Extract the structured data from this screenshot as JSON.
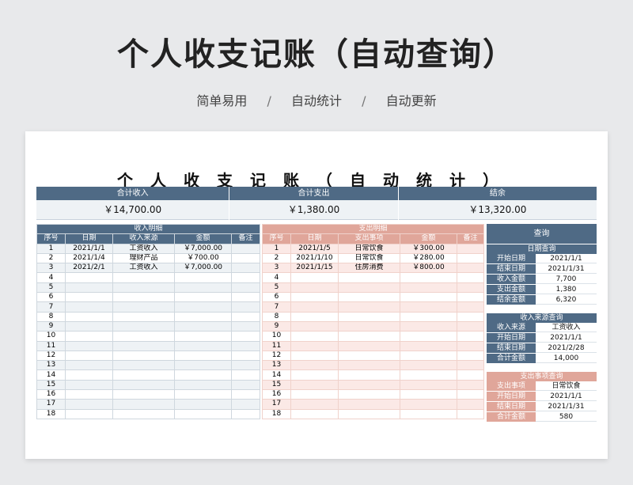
{
  "title": "个人收支记账（自动查询）",
  "subtitle": [
    "简单易用",
    "自动统计",
    "自动更新"
  ],
  "subtitle_sep": "/",
  "sheet": {
    "title": "个人收支记账（自动统计）",
    "summary": [
      {
        "label": "合计收入",
        "value": "￥14,700.00"
      },
      {
        "label": "合计支出",
        "value": "￥1,380.00"
      },
      {
        "label": "结余",
        "value": "￥13,320.00"
      }
    ],
    "income": {
      "title": "收入明细",
      "columns": [
        "序号",
        "日期",
        "收入来源",
        "金额",
        "备注"
      ],
      "rows": [
        [
          "1",
          "2021/1/1",
          "工资收入",
          "￥7,000.00",
          ""
        ],
        [
          "2",
          "2021/1/4",
          "理财产品",
          "￥700.00",
          ""
        ],
        [
          "3",
          "2021/2/1",
          "工资收入",
          "￥7,000.00",
          ""
        ],
        [
          "4",
          "",
          "",
          "",
          ""
        ],
        [
          "5",
          "",
          "",
          "",
          ""
        ],
        [
          "6",
          "",
          "",
          "",
          ""
        ],
        [
          "7",
          "",
          "",
          "",
          ""
        ],
        [
          "8",
          "",
          "",
          "",
          ""
        ],
        [
          "9",
          "",
          "",
          "",
          ""
        ],
        [
          "10",
          "",
          "",
          "",
          ""
        ],
        [
          "11",
          "",
          "",
          "",
          ""
        ],
        [
          "12",
          "",
          "",
          "",
          ""
        ],
        [
          "13",
          "",
          "",
          "",
          ""
        ],
        [
          "14",
          "",
          "",
          "",
          ""
        ],
        [
          "15",
          "",
          "",
          "",
          ""
        ],
        [
          "16",
          "",
          "",
          "",
          ""
        ],
        [
          "17",
          "",
          "",
          "",
          ""
        ],
        [
          "18",
          "",
          "",
          "",
          ""
        ]
      ]
    },
    "expense": {
      "title": "支出明细",
      "columns": [
        "序号",
        "日期",
        "支出事项",
        "金额",
        "备注"
      ],
      "rows": [
        [
          "1",
          "2021/1/5",
          "日常饮食",
          "￥300.00",
          ""
        ],
        [
          "2",
          "2021/1/10",
          "日常饮食",
          "￥280.00",
          ""
        ],
        [
          "3",
          "2021/1/15",
          "住房消费",
          "￥800.00",
          ""
        ],
        [
          "4",
          "",
          "",
          "",
          ""
        ],
        [
          "5",
          "",
          "",
          "",
          ""
        ],
        [
          "6",
          "",
          "",
          "",
          ""
        ],
        [
          "7",
          "",
          "",
          "",
          ""
        ],
        [
          "8",
          "",
          "",
          "",
          ""
        ],
        [
          "9",
          "",
          "",
          "",
          ""
        ],
        [
          "10",
          "",
          "",
          "",
          ""
        ],
        [
          "11",
          "",
          "",
          "",
          ""
        ],
        [
          "12",
          "",
          "",
          "",
          ""
        ],
        [
          "13",
          "",
          "",
          "",
          ""
        ],
        [
          "14",
          "",
          "",
          "",
          ""
        ],
        [
          "15",
          "",
          "",
          "",
          ""
        ],
        [
          "16",
          "",
          "",
          "",
          ""
        ],
        [
          "17",
          "",
          "",
          "",
          ""
        ],
        [
          "18",
          "",
          "",
          "",
          ""
        ]
      ]
    },
    "query": {
      "title": "查询",
      "date_query": {
        "title": "日期查询",
        "rows": [
          [
            "开始日期",
            "2021/1/1"
          ],
          [
            "结束日期",
            "2021/1/31"
          ],
          [
            "收入金额",
            "7,700"
          ],
          [
            "支出金额",
            "1,380"
          ],
          [
            "结余金额",
            "6,320"
          ]
        ]
      },
      "source_query": {
        "title": "收入来源查询",
        "rows": [
          [
            "收入来源",
            "工资收入"
          ],
          [
            "开始日期",
            "2021/1/1"
          ],
          [
            "结束日期",
            "2021/2/28"
          ],
          [
            "合计金额",
            "14,000"
          ]
        ]
      },
      "expense_query": {
        "title": "支出事项查询",
        "rows": [
          [
            "支出事项",
            "日常饮食"
          ],
          [
            "开始日期",
            "2021/1/1"
          ],
          [
            "结束日期",
            "2021/1/31"
          ],
          [
            "合计金额",
            "580"
          ]
        ]
      }
    }
  }
}
